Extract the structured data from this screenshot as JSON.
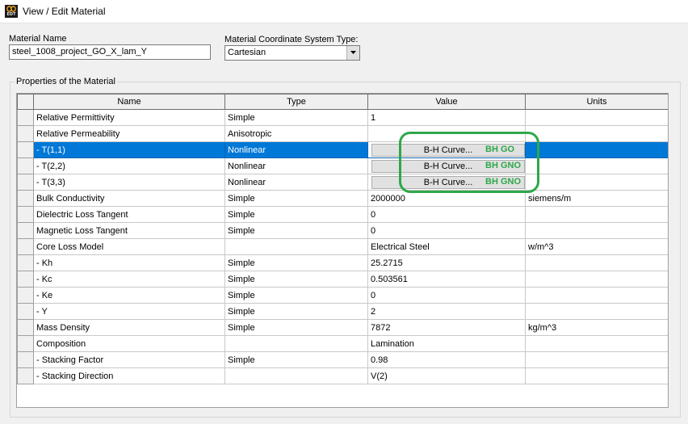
{
  "window": {
    "title": "View / Edit Material",
    "icon": "edt-app-icon"
  },
  "material_name": {
    "label": "Material Name",
    "value": "steel_1008_project_GO_X_lam_Y"
  },
  "coord_system": {
    "label": "Material Coordinate System Type:",
    "selected": "Cartesian"
  },
  "properties": {
    "group_label": "Properties of the Material",
    "columns": [
      "Name",
      "Type",
      "Value",
      "Units"
    ],
    "rows": [
      {
        "name": "Relative Permittivity",
        "type": "Simple",
        "value": "1",
        "units": ""
      },
      {
        "name": "Relative Permeability",
        "type": "Anisotropic",
        "value": "",
        "units": ""
      },
      {
        "name": "- T(1,1)",
        "type": "Nonlinear",
        "value": "B-H Curve...",
        "units": "",
        "selected": true
      },
      {
        "name": "- T(2,2)",
        "type": "Nonlinear",
        "value": "B-H Curve...",
        "units": ""
      },
      {
        "name": "- T(3,3)",
        "type": "Nonlinear",
        "value": "B-H Curve...",
        "units": ""
      },
      {
        "name": "Bulk Conductivity",
        "type": "Simple",
        "value": "2000000",
        "units": "siemens/m"
      },
      {
        "name": "Dielectric Loss Tangent",
        "type": "Simple",
        "value": "0",
        "units": ""
      },
      {
        "name": "Magnetic Loss Tangent",
        "type": "Simple",
        "value": "0",
        "units": ""
      },
      {
        "name": "Core Loss Model",
        "type": "",
        "value": "Electrical Steel",
        "units": "w/m^3"
      },
      {
        "name": "- Kh",
        "type": "Simple",
        "value": "25.2715",
        "units": ""
      },
      {
        "name": "- Kc",
        "type": "Simple",
        "value": "0.503561",
        "units": ""
      },
      {
        "name": "- Ke",
        "type": "Simple",
        "value": "0",
        "units": ""
      },
      {
        "name": "- Y",
        "type": "Simple",
        "value": "2",
        "units": ""
      },
      {
        "name": "Mass Density",
        "type": "Simple",
        "value": "7872",
        "units": "kg/m^3"
      },
      {
        "name": "Composition",
        "type": "",
        "value": "Lamination",
        "units": ""
      },
      {
        "name": "- Stacking Factor",
        "type": "Simple",
        "value": "0.98",
        "units": ""
      },
      {
        "name": "- Stacking Direction",
        "type": "",
        "value": "V(2)",
        "units": ""
      }
    ]
  },
  "annotations": {
    "bh_labels": [
      "BH GO",
      "BH GNO",
      "BH GNO"
    ],
    "color": "#2ea84a"
  },
  "colors": {
    "selection": "#0078d7",
    "background": "#f0f0f0"
  }
}
